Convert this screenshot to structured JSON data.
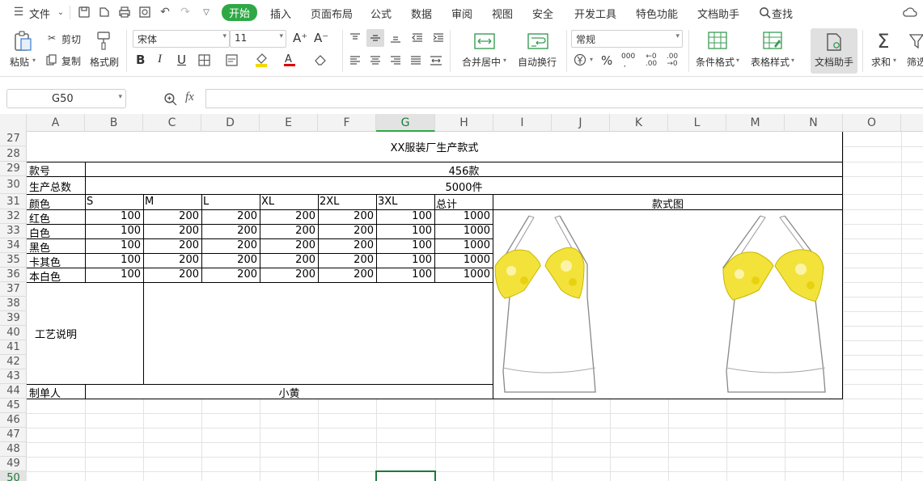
{
  "menubar": {
    "file_label": "文件",
    "tabs": [
      {
        "label": "开始",
        "active": true
      },
      {
        "label": "插入"
      },
      {
        "label": "页面布局"
      },
      {
        "label": "公式"
      },
      {
        "label": "数据"
      },
      {
        "label": "审阅"
      },
      {
        "label": "视图"
      },
      {
        "label": "安全"
      },
      {
        "label": "开发工具"
      },
      {
        "label": "特色功能"
      },
      {
        "label": "文档助手"
      }
    ],
    "search_label": "查找"
  },
  "ribbon": {
    "paste": "粘贴",
    "cut": "剪切",
    "copy": "复制",
    "format_painter": "格式刷",
    "font_name": "宋体",
    "font_size": "11",
    "increase_font": "A⁺",
    "decrease_font": "A⁻",
    "bold": "B",
    "italic": "I",
    "underline": "U",
    "merge_center": "合并居中",
    "wrap_text": "自动换行",
    "number_format": "常规",
    "percent": "%",
    "thousands": "000",
    "conditional_format": "条件格式",
    "table_style": "表格样式",
    "doc_assistant": "文档助手",
    "sum": "求和",
    "filter": "筛选"
  },
  "formula_bar": {
    "cell_ref": "G50",
    "fx": "fx",
    "value": ""
  },
  "columns": [
    "A",
    "B",
    "C",
    "D",
    "E",
    "F",
    "G",
    "H",
    "I",
    "J",
    "K",
    "L",
    "M",
    "N",
    "O"
  ],
  "rows": [
    "27",
    "28",
    "29",
    "30",
    "31",
    "32",
    "33",
    "34",
    "35",
    "36",
    "37",
    "38",
    "39",
    "40",
    "41",
    "42",
    "43",
    "44",
    "45",
    "46",
    "47",
    "48",
    "49",
    "50"
  ],
  "sheet": {
    "title": "XX服装厂生产款式",
    "style_no_label": "款号",
    "style_no": "456款",
    "total_label": "生产总数",
    "total": "5000件",
    "color_header": "颜色",
    "sizes": [
      "S",
      "M",
      "L",
      "XL",
      "2XL",
      "3XL",
      "总计"
    ],
    "image_header": "款式图",
    "color_rows": [
      {
        "color": "红色",
        "values": [
          "100",
          "200",
          "200",
          "200",
          "200",
          "100",
          "1000"
        ]
      },
      {
        "color": "白色",
        "values": [
          "100",
          "200",
          "200",
          "200",
          "200",
          "100",
          "1000"
        ]
      },
      {
        "color": "黑色",
        "values": [
          "100",
          "200",
          "200",
          "200",
          "200",
          "100",
          "1000"
        ]
      },
      {
        "color": "卡其色",
        "values": [
          "100",
          "200",
          "200",
          "200",
          "200",
          "100",
          "1000"
        ]
      },
      {
        "color": "本白色",
        "values": [
          "100",
          "200",
          "200",
          "200",
          "200",
          "100",
          "1000"
        ]
      }
    ],
    "process_label": "工艺说明",
    "maker_label": "制单人",
    "maker": "小黄"
  },
  "colors": {
    "accent": "#2ea844",
    "selection": "#1e7a3a"
  }
}
